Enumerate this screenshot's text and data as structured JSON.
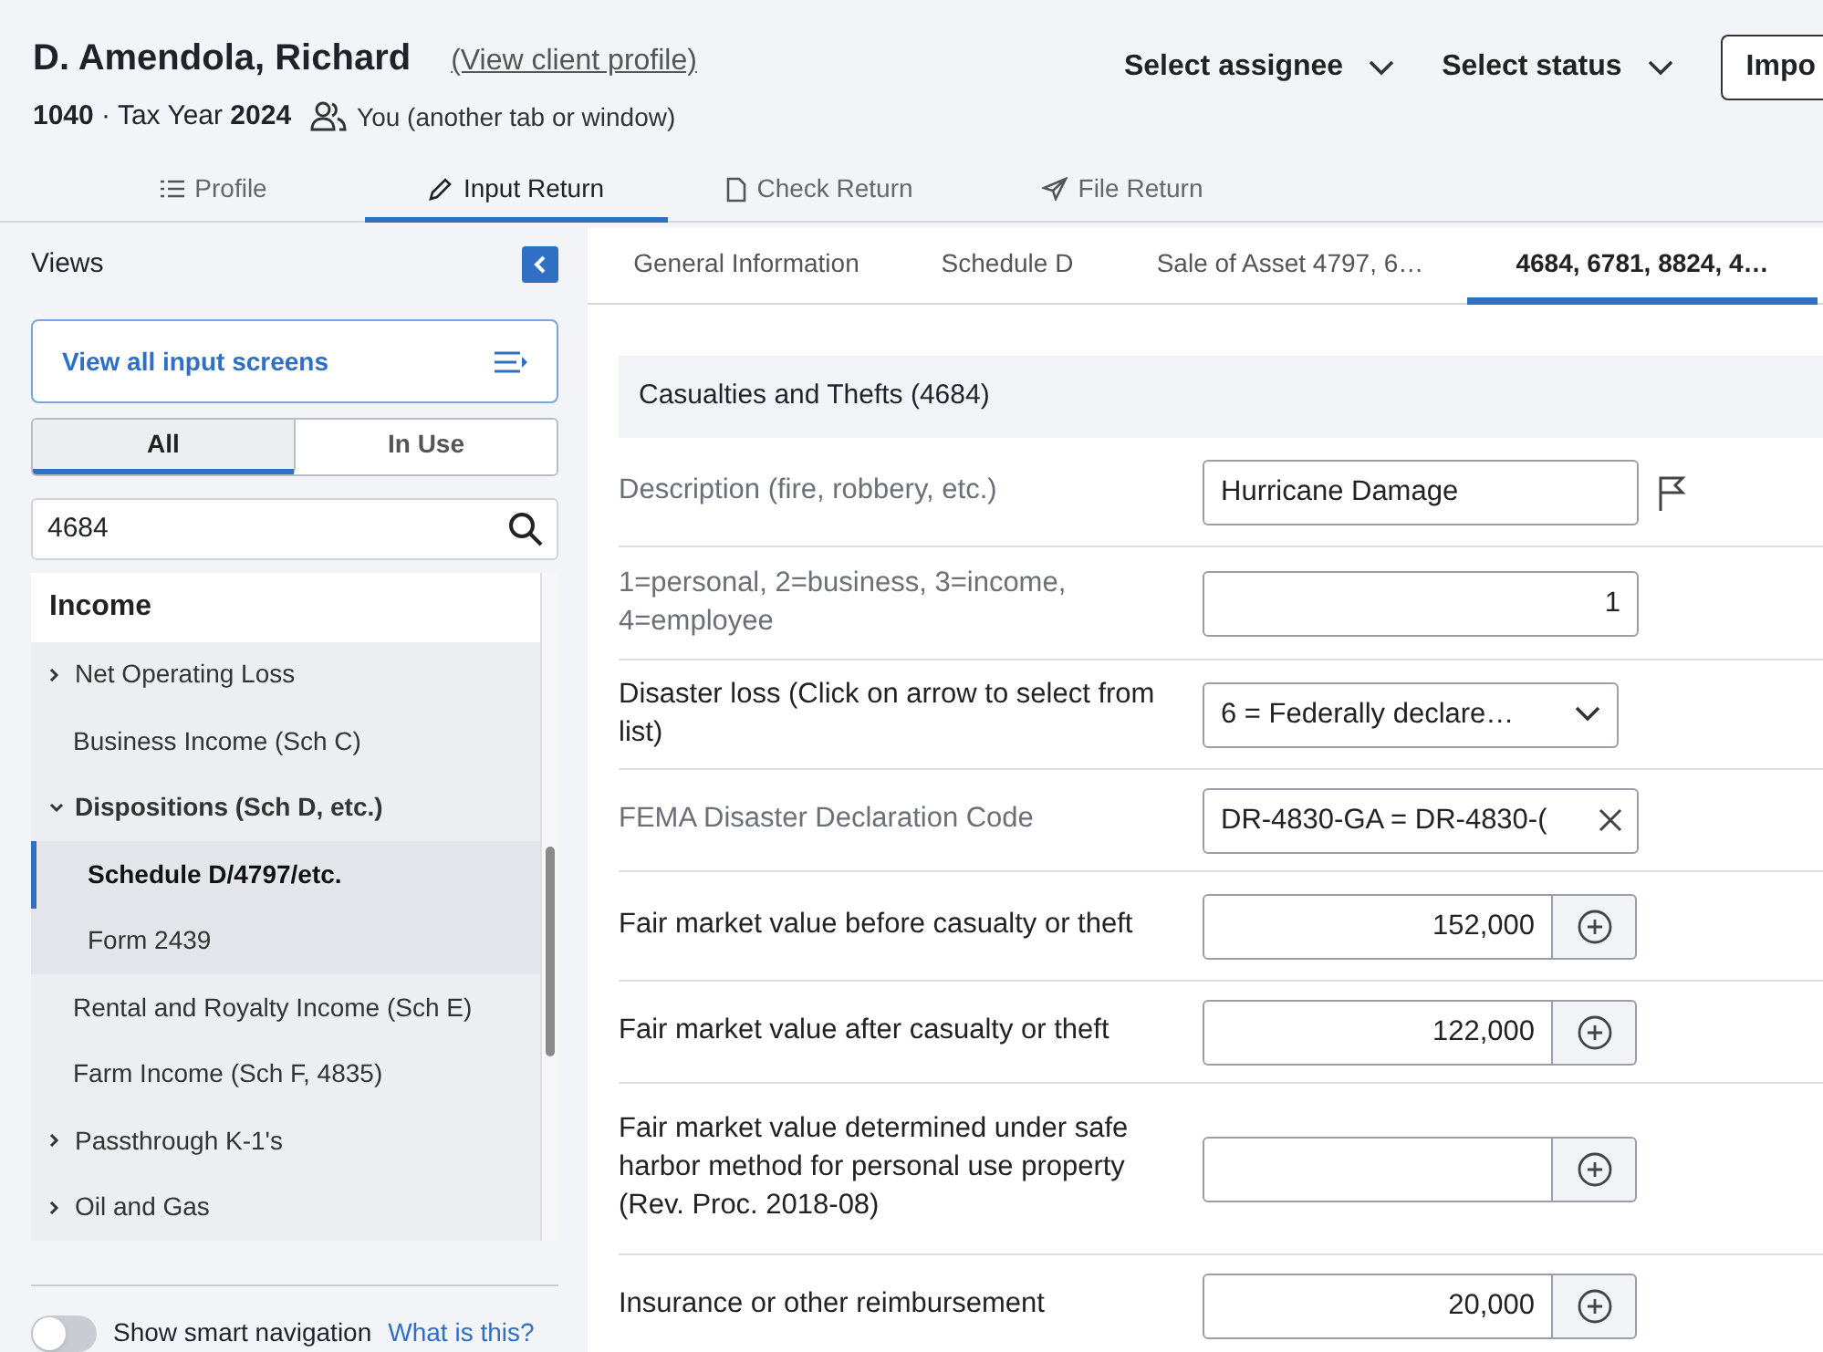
{
  "client": {
    "name": "D. Amendola, Richard",
    "profile_link": "(View client profile)",
    "form": "1040",
    "separator": "·",
    "year_label": "Tax Year",
    "year": "2024",
    "presence": "You (another tab or window)"
  },
  "header_actions": [
    {
      "kind": "dropdown",
      "label": "Select assignee"
    },
    {
      "kind": "dropdown",
      "label": "Select status"
    },
    {
      "kind": "button",
      "label": "Impo"
    }
  ],
  "main_tabs": [
    {
      "label": "Profile",
      "selected": false
    },
    {
      "label": "Input Return",
      "selected": true
    },
    {
      "label": "Check Return",
      "selected": false
    },
    {
      "label": "File Return",
      "selected": false
    }
  ],
  "sidebar": {
    "title": "Views",
    "view_all": "View all input screens",
    "filters": [
      {
        "label": "All",
        "selected": true
      },
      {
        "label": "In Use",
        "selected": false
      }
    ],
    "search": {
      "value": "4684"
    },
    "section": "Income",
    "items": [
      {
        "kind": "group",
        "label": "Net Operating Loss",
        "expanded": false,
        "selected": false
      },
      {
        "kind": "leaf",
        "label": "Business Income (Sch C)",
        "selected": false
      },
      {
        "kind": "group",
        "label": "Dispositions (Sch D, etc.)",
        "expanded": true,
        "selected": false,
        "children": [
          {
            "label": "Schedule D/4797/etc.",
            "selected": true
          },
          {
            "label": "Form 2439",
            "selected": false
          }
        ]
      },
      {
        "kind": "leaf",
        "label": "Rental and Royalty Income (Sch E)",
        "selected": false
      },
      {
        "kind": "leaf",
        "label": "Farm Income (Sch F, 4835)",
        "selected": false
      },
      {
        "kind": "group",
        "label": "Passthrough K-1's",
        "expanded": false,
        "selected": false
      },
      {
        "kind": "group",
        "label": "Oil and Gas",
        "expanded": false,
        "selected": false
      }
    ],
    "smart_navigation": {
      "label": "Show smart navigation",
      "on": false,
      "link": "What is this?"
    }
  },
  "form_tabs": [
    {
      "label": "General Information",
      "selected": false
    },
    {
      "label": "Schedule D",
      "selected": false
    },
    {
      "label": "Sale of Asset 4797, 6…",
      "selected": false
    },
    {
      "label": "4684, 6781, 8824, 4…",
      "selected": true
    }
  ],
  "form": {
    "title": "Casualties and Thefts (4684)",
    "rows": [
      {
        "kind": "text",
        "label": "Description (fire, robbery, etc.)",
        "dimmed": true,
        "value": "Hurricane Damage",
        "flag": true
      },
      {
        "kind": "number",
        "label": "1=personal, 2=business, 3=income, 4=employee",
        "dimmed": true,
        "value": "1"
      },
      {
        "kind": "select",
        "label": "Disaster loss (Click on arrow to select from list)",
        "dimmed": false,
        "value": "6 = Federally declare…"
      },
      {
        "kind": "clearable",
        "label": "FEMA Disaster Declaration Code",
        "dimmed": true,
        "value": "DR-4830-GA = DR-4830-("
      },
      {
        "kind": "amount",
        "label": "Fair market value before casualty or theft",
        "dimmed": false,
        "value": "152,000"
      },
      {
        "kind": "amount",
        "label": "Fair market value after casualty or theft",
        "dimmed": false,
        "value": "122,000"
      },
      {
        "kind": "amount",
        "label": "Fair market value determined under safe harbor method for personal use property (Rev. Proc. 2018-08)",
        "dimmed": false
      },
      {
        "kind": "amount",
        "label": "Insurance or other reimbursement",
        "dimmed": false,
        "value": "20,000"
      }
    ]
  }
}
